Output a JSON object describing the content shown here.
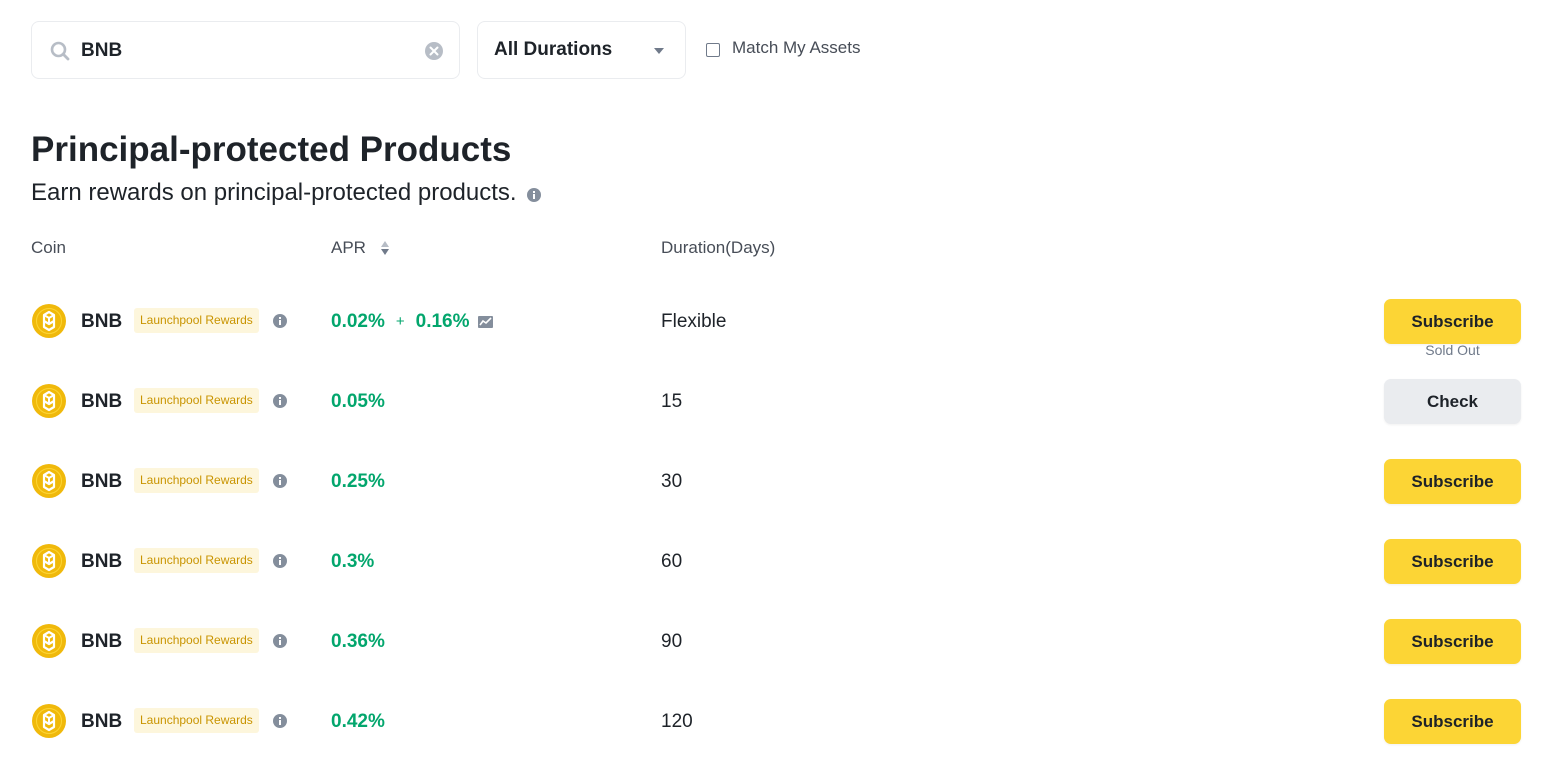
{
  "filters": {
    "search_value": "BNB",
    "search_icon": "search-icon",
    "clear_icon": "close-circle-icon",
    "duration_selected": "All Durations",
    "match_assets_label": "Match My Assets",
    "match_assets_checked": false
  },
  "section": {
    "title": "Principal-protected Products",
    "subtitle": "Earn rewards on principal-protected products."
  },
  "table": {
    "columns": {
      "coin": "Coin",
      "apr": "APR",
      "duration": "Duration(Days)"
    },
    "rows": [
      {
        "coin": "BNB",
        "tag": "Launchpool Rewards",
        "apr": "0.02%",
        "apr_plus": "+",
        "apr_bonus": "0.16%",
        "has_chart": true,
        "duration": "Flexible",
        "action": "Subscribe",
        "status": ""
      },
      {
        "coin": "BNB",
        "tag": "Launchpool Rewards",
        "apr": "0.05%",
        "duration": "15",
        "action": "Check",
        "status": "Sold Out"
      },
      {
        "coin": "BNB",
        "tag": "Launchpool Rewards",
        "apr": "0.25%",
        "duration": "30",
        "action": "Subscribe",
        "status": ""
      },
      {
        "coin": "BNB",
        "tag": "Launchpool Rewards",
        "apr": "0.3%",
        "duration": "60",
        "action": "Subscribe",
        "status": ""
      },
      {
        "coin": "BNB",
        "tag": "Launchpool Rewards",
        "apr": "0.36%",
        "duration": "90",
        "action": "Subscribe",
        "status": ""
      },
      {
        "coin": "BNB",
        "tag": "Launchpool Rewards",
        "apr": "0.42%",
        "duration": "120",
        "action": "Subscribe",
        "status": ""
      }
    ]
  },
  "colors": {
    "accent": "#fcd535",
    "apr_green": "#03a66d",
    "tag_text": "#c99400",
    "tag_bg": "#fdf6dc",
    "bnb_yellow": "#f0b90b"
  }
}
